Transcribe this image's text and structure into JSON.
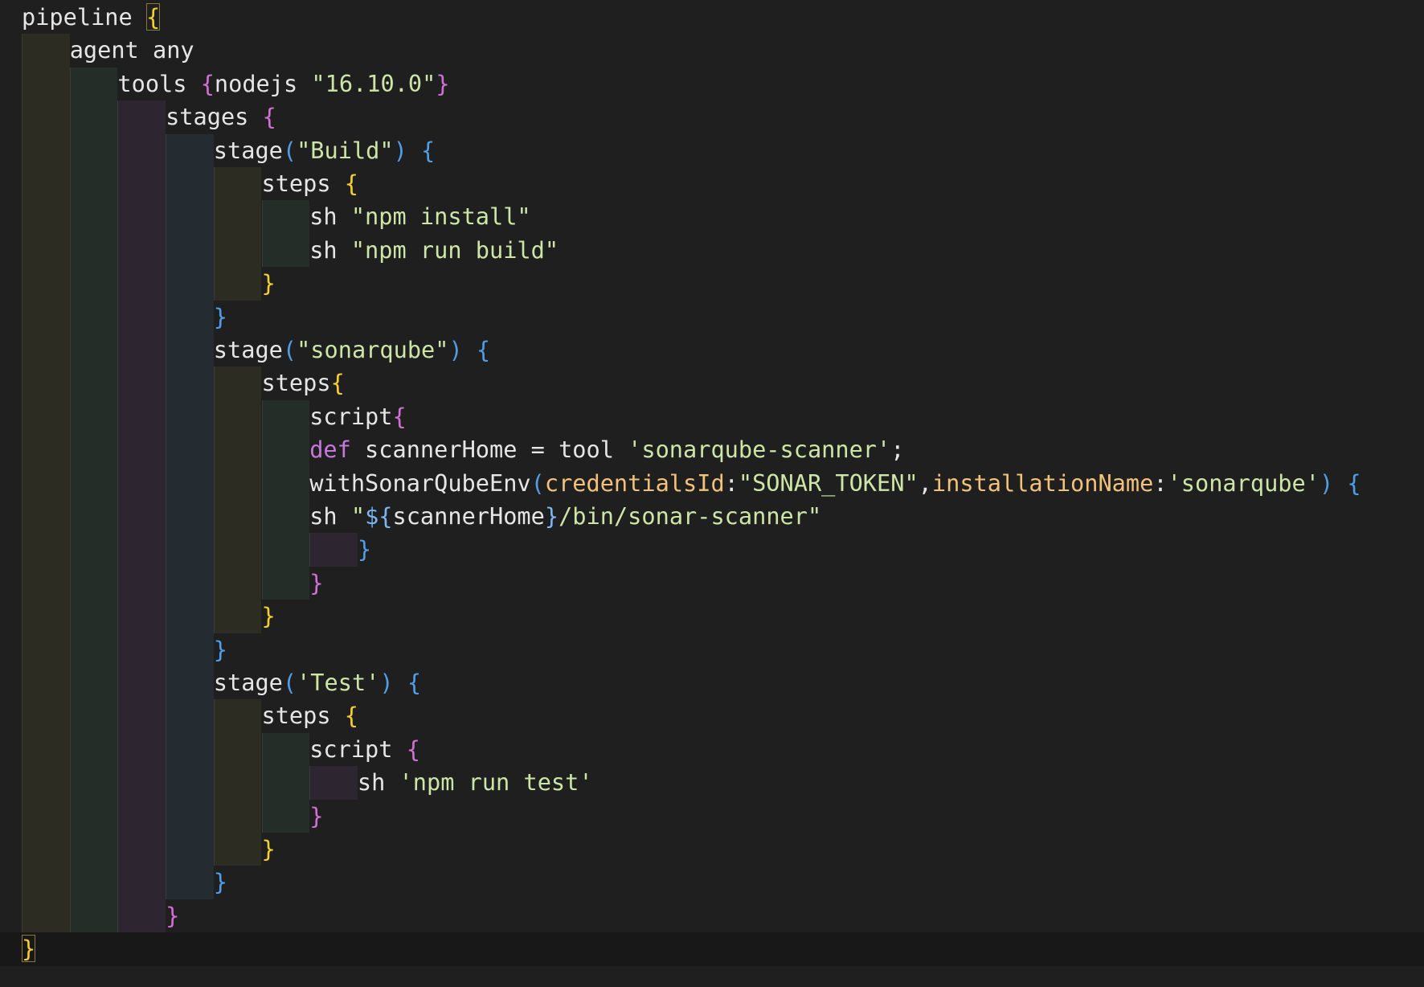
{
  "editor": {
    "language": "groovy",
    "lines": [
      {
        "indent": 0,
        "tokens": [
          {
            "t": "pipeline ",
            "c": "plain"
          },
          {
            "t": "{",
            "c": "b1",
            "match": true
          }
        ]
      },
      {
        "indent": 1,
        "tokens": [
          {
            "t": "agent any",
            "c": "plain"
          }
        ]
      },
      {
        "indent": 2,
        "tokens": [
          {
            "t": "tools ",
            "c": "plain"
          },
          {
            "t": "{",
            "c": "b2"
          },
          {
            "t": "nodejs ",
            "c": "plain"
          },
          {
            "t": "\"16.10.0\"",
            "c": "str"
          },
          {
            "t": "}",
            "c": "b2"
          }
        ]
      },
      {
        "indent": 3,
        "tokens": [
          {
            "t": "stages ",
            "c": "plain"
          },
          {
            "t": "{",
            "c": "b2"
          }
        ]
      },
      {
        "indent": 4,
        "tokens": [
          {
            "t": "stage",
            "c": "plain"
          },
          {
            "t": "(",
            "c": "b3"
          },
          {
            "t": "\"Build\"",
            "c": "str"
          },
          {
            "t": ")",
            "c": "b3"
          },
          {
            "t": " ",
            "c": "plain"
          },
          {
            "t": "{",
            "c": "b3"
          }
        ]
      },
      {
        "indent": 5,
        "tokens": [
          {
            "t": "steps ",
            "c": "plain"
          },
          {
            "t": "{",
            "c": "b1"
          }
        ]
      },
      {
        "indent": 6,
        "tokens": [
          {
            "t": "sh ",
            "c": "plain"
          },
          {
            "t": "\"npm install\"",
            "c": "str"
          }
        ]
      },
      {
        "indent": 6,
        "tokens": [
          {
            "t": "sh ",
            "c": "plain"
          },
          {
            "t": "\"npm run build\"",
            "c": "str"
          }
        ]
      },
      {
        "indent": 5,
        "tokens": [
          {
            "t": "}",
            "c": "b1"
          }
        ]
      },
      {
        "indent": 4,
        "tokens": [
          {
            "t": "}",
            "c": "b3"
          }
        ]
      },
      {
        "indent": 4,
        "tokens": [
          {
            "t": "stage",
            "c": "plain"
          },
          {
            "t": "(",
            "c": "b3"
          },
          {
            "t": "\"sonarqube\"",
            "c": "str"
          },
          {
            "t": ")",
            "c": "b3"
          },
          {
            "t": " ",
            "c": "plain"
          },
          {
            "t": "{",
            "c": "b3"
          }
        ]
      },
      {
        "indent": 5,
        "tokens": [
          {
            "t": "steps",
            "c": "plain"
          },
          {
            "t": "{",
            "c": "b1"
          }
        ]
      },
      {
        "indent": 6,
        "tokens": [
          {
            "t": "script",
            "c": "plain"
          },
          {
            "t": "{",
            "c": "b2"
          }
        ]
      },
      {
        "indent": 6,
        "tokens": [
          {
            "t": "def",
            "c": "kw"
          },
          {
            "t": " scannerHome = tool ",
            "c": "plain"
          },
          {
            "t": "'sonarqube-scanner'",
            "c": "str"
          },
          {
            "t": ";",
            "c": "plain"
          }
        ]
      },
      {
        "indent": 6,
        "tokens": [
          {
            "t": "withSonarQubeEnv",
            "c": "plain"
          },
          {
            "t": "(",
            "c": "b3"
          },
          {
            "t": "credentialsId",
            "c": "param"
          },
          {
            "t": ":",
            "c": "plain"
          },
          {
            "t": "\"SONAR_TOKEN\"",
            "c": "str"
          },
          {
            "t": ",",
            "c": "plain"
          },
          {
            "t": "installationName",
            "c": "param"
          },
          {
            "t": ":",
            "c": "plain"
          },
          {
            "t": "'sonarqube'",
            "c": "str"
          },
          {
            "t": ")",
            "c": "b3"
          },
          {
            "t": " ",
            "c": "plain"
          },
          {
            "t": "{",
            "c": "b3"
          }
        ]
      },
      {
        "indent": 6,
        "tokens": [
          {
            "t": "sh ",
            "c": "plain"
          },
          {
            "t": "\"",
            "c": "str"
          },
          {
            "t": "${",
            "c": "tpl"
          },
          {
            "t": "scannerHome",
            "c": "var"
          },
          {
            "t": "}",
            "c": "tpl"
          },
          {
            "t": "/bin/sonar-scanner\"",
            "c": "str"
          }
        ]
      },
      {
        "indent": 7,
        "tokens": [
          {
            "t": "}",
            "c": "b3"
          }
        ]
      },
      {
        "indent": 6,
        "tokens": [
          {
            "t": "}",
            "c": "b2"
          }
        ]
      },
      {
        "indent": 5,
        "tokens": [
          {
            "t": "}",
            "c": "b1"
          }
        ]
      },
      {
        "indent": 4,
        "tokens": [
          {
            "t": "}",
            "c": "b3"
          }
        ]
      },
      {
        "indent": 4,
        "tokens": [
          {
            "t": "stage",
            "c": "plain"
          },
          {
            "t": "(",
            "c": "b3"
          },
          {
            "t": "'Test'",
            "c": "str"
          },
          {
            "t": ")",
            "c": "b3"
          },
          {
            "t": " ",
            "c": "plain"
          },
          {
            "t": "{",
            "c": "b3"
          }
        ]
      },
      {
        "indent": 5,
        "tokens": [
          {
            "t": "steps ",
            "c": "plain"
          },
          {
            "t": "{",
            "c": "b1"
          }
        ]
      },
      {
        "indent": 6,
        "tokens": [
          {
            "t": "script ",
            "c": "plain"
          },
          {
            "t": "{",
            "c": "b2"
          }
        ]
      },
      {
        "indent": 7,
        "tokens": [
          {
            "t": "sh ",
            "c": "plain"
          },
          {
            "t": "'npm run test'",
            "c": "str"
          }
        ]
      },
      {
        "indent": 6,
        "tokens": [
          {
            "t": "}",
            "c": "b2"
          }
        ]
      },
      {
        "indent": 5,
        "tokens": [
          {
            "t": "}",
            "c": "b1"
          }
        ]
      },
      {
        "indent": 4,
        "tokens": [
          {
            "t": "}",
            "c": "b3"
          }
        ]
      },
      {
        "indent": 3,
        "tokens": [
          {
            "t": "}",
            "c": "b2"
          }
        ]
      },
      {
        "indent": 0,
        "current": true,
        "tokens": [
          {
            "t": "}",
            "c": "b1",
            "match": true
          }
        ]
      }
    ]
  },
  "colors": {
    "background": "#1f1f1f",
    "current_line": "#181818",
    "text": "#e6e6e6",
    "string": "#cde6a8",
    "keyword": "#c678dd",
    "parameter": "#f2c27a",
    "template": "#79b6f2",
    "bracket_level_1": "#f5d02a",
    "bracket_level_2": "#d16fd6",
    "bracket_level_3": "#4f9ee8"
  }
}
